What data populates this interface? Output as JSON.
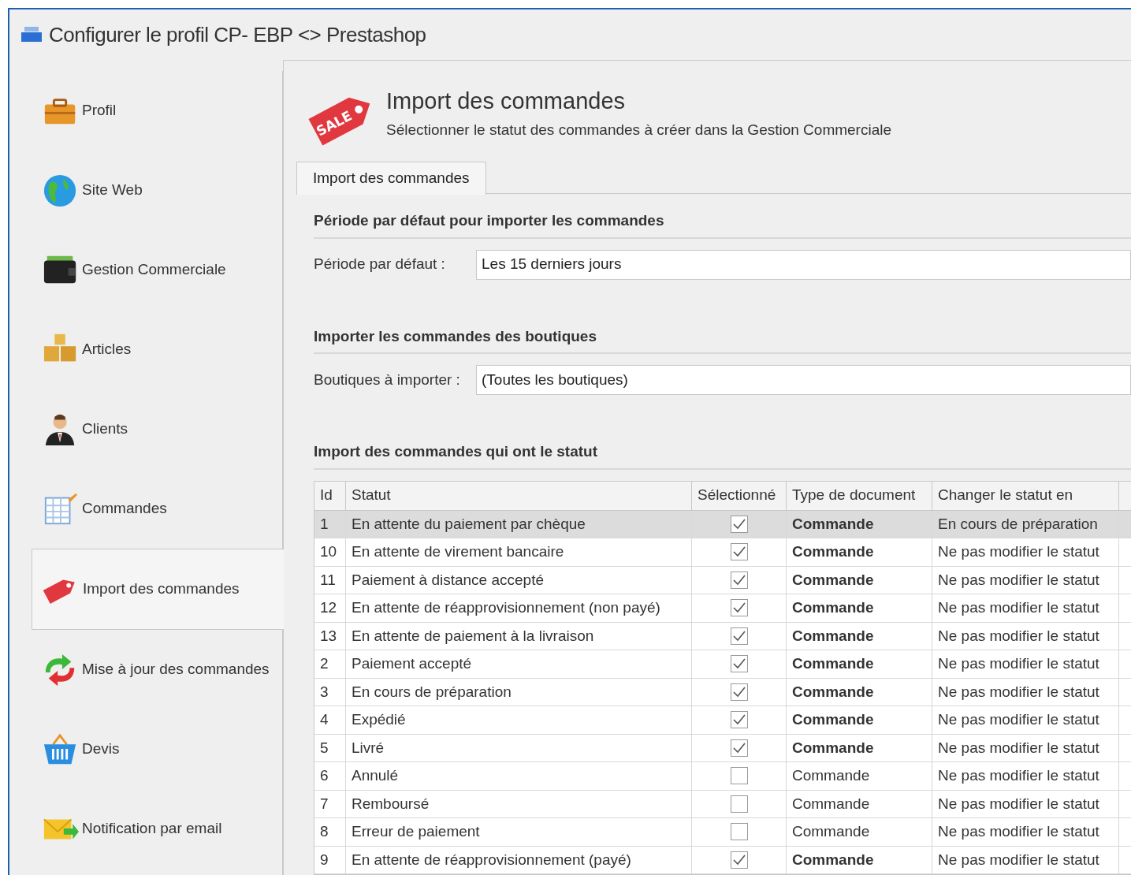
{
  "window": {
    "title": "Configurer le profil CP- EBP <> Prestashop"
  },
  "sidebar": {
    "items": [
      {
        "label": "Profil",
        "selected": false
      },
      {
        "label": "Site Web",
        "selected": false
      },
      {
        "label": "Gestion Commerciale",
        "selected": false
      },
      {
        "label": "Articles",
        "selected": false
      },
      {
        "label": "Clients",
        "selected": false
      },
      {
        "label": "Commandes",
        "selected": false
      },
      {
        "label": "Import des commandes",
        "selected": true
      },
      {
        "label": "Mise à jour des commandes",
        "selected": false
      },
      {
        "label": "Devis",
        "selected": false
      },
      {
        "label": "Notification par email",
        "selected": false
      }
    ]
  },
  "header": {
    "icon_text": "SALE",
    "title": "Import des commandes",
    "subtitle": "Sélectionner le statut des commandes à créer dans la Gestion Commerciale"
  },
  "tabs": [
    {
      "label": "Import des commandes",
      "selected": true
    }
  ],
  "sections": [
    {
      "heading": "Période par défaut pour importer les commandes",
      "field": {
        "label": "Période par défaut :",
        "value": "Les 15 derniers jours"
      }
    },
    {
      "heading": "Importer les commandes des boutiques",
      "field": {
        "label": "Boutiques à importer :",
        "value": "(Toutes les boutiques)"
      }
    },
    {
      "heading": "Import des commandes qui ont le statut"
    }
  ],
  "table": {
    "columns": [
      "Id",
      "Statut",
      "Sélectionné",
      "Type de document",
      "Changer le statut en"
    ],
    "rows": [
      {
        "id": "1",
        "statut": "En attente du paiement par chèque",
        "checked": true,
        "type": "Commande",
        "change": "En cours de préparation",
        "selected": true
      },
      {
        "id": "10",
        "statut": "En attente de virement bancaire",
        "checked": true,
        "type": "Commande",
        "change": "Ne pas modifier le statut",
        "selected": false
      },
      {
        "id": "11",
        "statut": "Paiement à distance accepté",
        "checked": true,
        "type": "Commande",
        "change": "Ne pas modifier le statut",
        "selected": false
      },
      {
        "id": "12",
        "statut": "En attente de réapprovisionnement (non payé)",
        "checked": true,
        "type": "Commande",
        "change": "Ne pas modifier le statut",
        "selected": false
      },
      {
        "id": "13",
        "statut": "En attente de paiement à la livraison",
        "checked": true,
        "type": "Commande",
        "change": "Ne pas modifier le statut",
        "selected": false
      },
      {
        "id": "2",
        "statut": "Paiement accepté",
        "checked": true,
        "type": "Commande",
        "change": "Ne pas modifier le statut",
        "selected": false
      },
      {
        "id": "3",
        "statut": "En cours de préparation",
        "checked": true,
        "type": "Commande",
        "change": "Ne pas modifier le statut",
        "selected": false
      },
      {
        "id": "4",
        "statut": "Expédié",
        "checked": true,
        "type": "Commande",
        "change": "Ne pas modifier le statut",
        "selected": false
      },
      {
        "id": "5",
        "statut": "Livré",
        "checked": true,
        "type": "Commande",
        "change": "Ne pas modifier le statut",
        "selected": false
      },
      {
        "id": "6",
        "statut": "Annulé",
        "checked": false,
        "type": "Commande",
        "change": "Ne pas modifier le statut",
        "selected": false
      },
      {
        "id": "7",
        "statut": "Remboursé",
        "checked": false,
        "type": "Commande",
        "change": "Ne pas modifier le statut",
        "selected": false
      },
      {
        "id": "8",
        "statut": "Erreur de paiement",
        "checked": false,
        "type": "Commande",
        "change": "Ne pas modifier le statut",
        "selected": false
      },
      {
        "id": "9",
        "statut": "En attente de réapprovisionnement (payé)",
        "checked": true,
        "type": "Commande",
        "change": "Ne pas modifier le statut",
        "selected": false
      }
    ]
  }
}
